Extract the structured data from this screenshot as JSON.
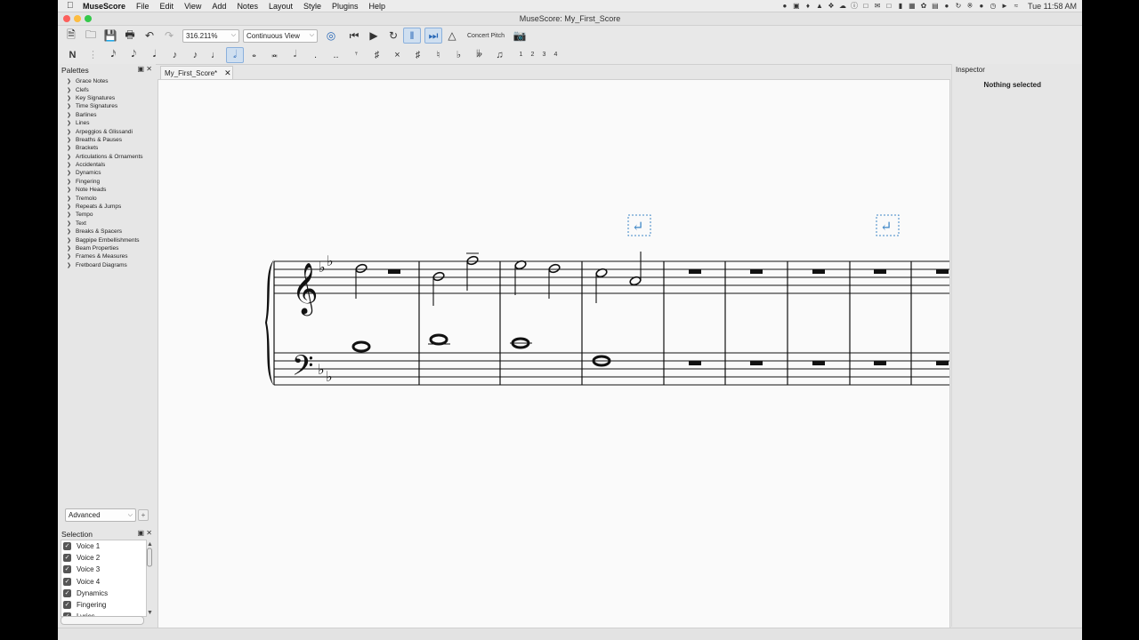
{
  "menubar": {
    "app_name": "MuseScore",
    "items": [
      "File",
      "Edit",
      "View",
      "Add",
      "Notes",
      "Layout",
      "Style",
      "Plugins",
      "Help"
    ],
    "clock": "Tue 11:58 AM"
  },
  "window": {
    "title": "MuseScore: My_First_Score"
  },
  "toolbar": {
    "zoom_value": "316.211%",
    "view_mode": "Continuous View",
    "concert_pitch": "Concert Pitch"
  },
  "note_input": {
    "voices": [
      "1",
      "2",
      "3",
      "4"
    ]
  },
  "palettes": {
    "title": "Palettes",
    "items": [
      "Grace Notes",
      "Clefs",
      "Key Signatures",
      "Time Signatures",
      "Barlines",
      "Lines",
      "Arpeggios & Glissandi",
      "Breaths & Pauses",
      "Brackets",
      "Articulations & Ornaments",
      "Accidentals",
      "Dynamics",
      "Fingering",
      "Note Heads",
      "Tremolo",
      "Repeats & Jumps",
      "Tempo",
      "Text",
      "Breaks & Spacers",
      "Bagpipe Embellishments",
      "Beam Properties",
      "Frames & Measures",
      "Fretboard Diagrams"
    ],
    "workspace": "Advanced"
  },
  "selection": {
    "title": "Selection",
    "items": [
      "Voice 1",
      "Voice 2",
      "Voice 3",
      "Voice 4",
      "Dynamics",
      "Fingering",
      "Lyrics"
    ]
  },
  "score": {
    "tab_label": "My_First_Score*"
  },
  "inspector": {
    "title": "Inspector",
    "message": "Nothing selected"
  },
  "colors": {
    "accent": "#2465b6",
    "score_bg": "#fafafa",
    "panel_bg": "#e6e6e6"
  }
}
